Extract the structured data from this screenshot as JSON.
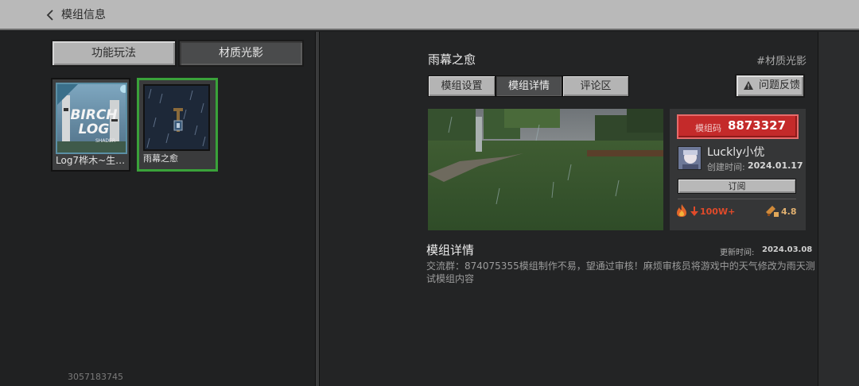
{
  "header": {
    "title": "模组信息"
  },
  "left": {
    "category_tabs": [
      {
        "label": "功能玩法",
        "active": false
      },
      {
        "label": "材质光影",
        "active": true
      }
    ],
    "mods": [
      {
        "name": "Log7桦木~生…",
        "thumb_text": "BIRCH LOG",
        "thumb_sub": "SHADER",
        "selected": false
      },
      {
        "name": "雨幕之愈",
        "selected": true
      }
    ],
    "player_id": "3057183745"
  },
  "detail": {
    "title": "雨幕之愈",
    "tag": "#材质光影",
    "tabs": [
      {
        "label": "模组设置",
        "active": false
      },
      {
        "label": "模组详情",
        "active": true
      },
      {
        "label": "评论区",
        "active": false
      }
    ],
    "report_label": "问题反馈",
    "code_label": "模组码",
    "code_value": "8873327",
    "author": "Luckly小优",
    "created_label": "创建时间:",
    "created_date": "2024.01.17",
    "subscribe_label": "订阅",
    "heat": "100W+",
    "rating": "4.8",
    "section_title": "模组详情",
    "update_label": "更新时间:",
    "update_date": "2024.03.08",
    "description": "交流群：874075355模组制作不易，望通过审核！麻烦审核员将游戏中的天气修改为雨天测试模组内容"
  },
  "colors": {
    "accent_green": "#3aa23a",
    "code_red": "#c42a2a",
    "heat_red": "#e04a2a"
  },
  "icons": [
    "back-chevron-icon",
    "warning-icon",
    "fire-icon",
    "down-arrow-icon",
    "rating-icon"
  ]
}
